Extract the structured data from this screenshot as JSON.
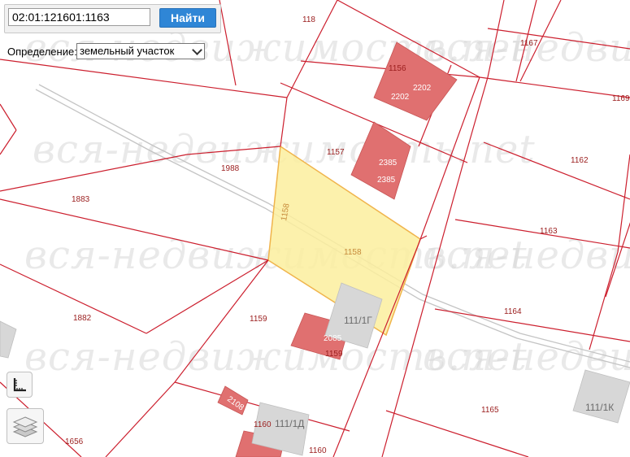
{
  "search": {
    "value": "02:01:121601:1163",
    "button_label": "Найти"
  },
  "definition": {
    "label": "Определение:",
    "selected": "земельный участок"
  },
  "watermark_text": "вся-недвижимость.net",
  "colors": {
    "boundary": "#cc1f2e",
    "building": "#e07070",
    "selected_fill": "#fbee9e",
    "selected_stroke": "#f0b44c",
    "road": "#c4c4c4",
    "capital_building": "#d7d7d7"
  },
  "parcels": {
    "p118": "118",
    "p1167": "1167",
    "p1156": "1156",
    "p1988": "1988",
    "p1157": "1157",
    "p1162": "1162",
    "p1883": "1883",
    "p1158_side": "1158",
    "p1158": "1158",
    "p1163": "1163",
    "p1882": "1882",
    "p1159": "1159",
    "p1164": "1164",
    "p1159b": "1159",
    "p1165": "1165",
    "p1160": "1160",
    "p1160b": "1160",
    "p1656": "1656",
    "p1169": "1169"
  },
  "buildings": {
    "b2202a": "2202",
    "b2202b": "2202",
    "b2385a": "2385",
    "b2385b": "2385",
    "b2085": "2085",
    "b2108": "2108"
  },
  "addresses": {
    "a111_1g": "111/1Г",
    "a111_1d": "111/1Д",
    "a111_1k": "111/1К"
  },
  "controls": {
    "measure_tool": "ruler-icon",
    "layers_tool": "layers-icon"
  }
}
